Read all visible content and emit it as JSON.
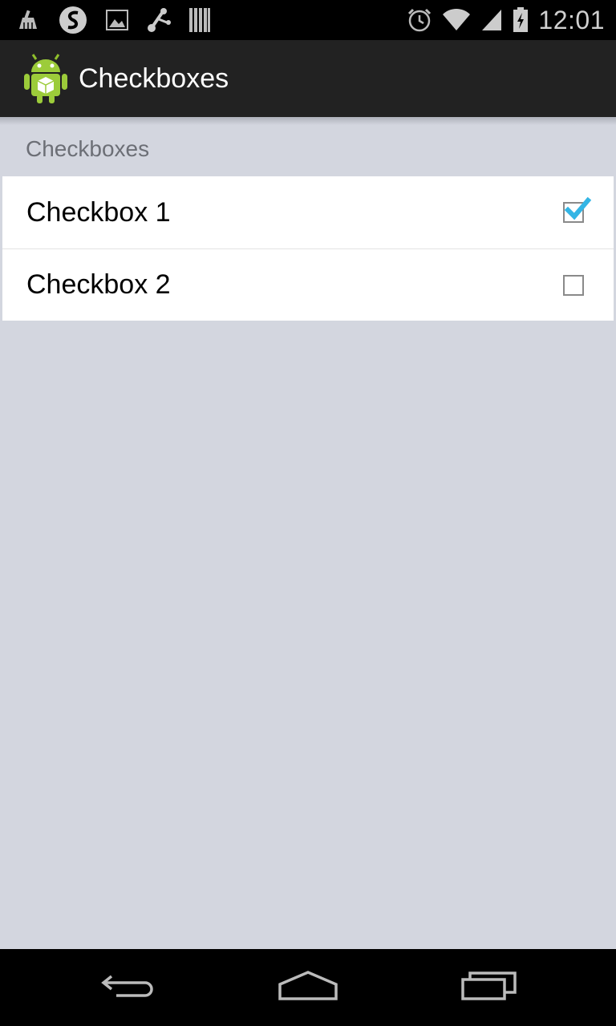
{
  "status_bar": {
    "left_icons": [
      "cleaner-icon",
      "swype-icon",
      "gallery-icon",
      "usb-debug-icon",
      "barcode-icon"
    ],
    "right_icons": [
      "alarm-icon",
      "wifi-icon",
      "signal-icon",
      "battery-charging-icon"
    ],
    "time": "12:01"
  },
  "action_bar": {
    "app_icon": "android-app-icon",
    "title": "Checkboxes"
  },
  "preferences": {
    "category_title": "Checkboxes",
    "items": [
      {
        "label": "Checkbox 1",
        "checked": true
      },
      {
        "label": "Checkbox 2",
        "checked": false
      }
    ]
  },
  "nav_bar": {
    "icons": [
      "back-icon",
      "home-icon",
      "recent-apps-icon"
    ]
  },
  "colors": {
    "check_accent": "#33b5e5",
    "background": "#d3d6df",
    "action_bar": "#222222"
  }
}
